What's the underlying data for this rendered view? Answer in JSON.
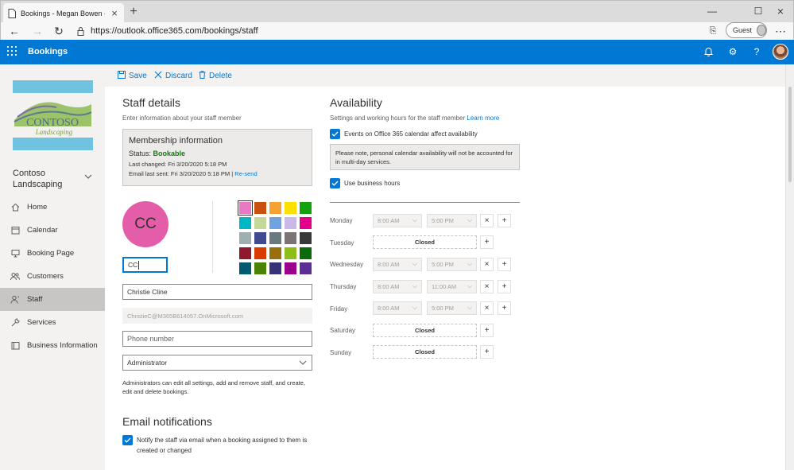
{
  "browser": {
    "tab_title": "Bookings - Megan Bowen - Outl",
    "url": "https://outlook.office365.com/bookings/staff",
    "guest_label": "Guest"
  },
  "app": {
    "title": "Bookings",
    "brand_color": "#0078d4"
  },
  "sidebar": {
    "logo_text": "CONTOSO",
    "logo_subtext": "Landscaping",
    "business_name": "Contoso Landscaping",
    "items": [
      {
        "label": "Home",
        "icon": "home-icon"
      },
      {
        "label": "Calendar",
        "icon": "calendar-icon"
      },
      {
        "label": "Booking Page",
        "icon": "monitor-icon"
      },
      {
        "label": "Customers",
        "icon": "people-icon"
      },
      {
        "label": "Staff",
        "icon": "staff-icon",
        "selected": true
      },
      {
        "label": "Services",
        "icon": "wrench-icon"
      },
      {
        "label": "Business Information",
        "icon": "building-icon"
      }
    ]
  },
  "toolbar": {
    "save_label": "Save",
    "discard_label": "Discard",
    "delete_label": "Delete"
  },
  "staff": {
    "heading": "Staff details",
    "subheading": "Enter information about your staff member",
    "membership": {
      "title": "Membership information",
      "status_label": "Status:",
      "status_value": "Bookable",
      "last_changed": "Last changed: Fri 3/20/2020 5:18 PM",
      "email_last_sent": "Email last sent: Fri 3/20/2020 5:18 PM |",
      "resend_label": "Re-send"
    },
    "initials_display": "CC",
    "initials_value": "CC",
    "name_value": "Christie Cline",
    "email_value": "ChristieC@M365B614057.OnMicrosoft.com",
    "phone_placeholder": "Phone number",
    "role_value": "Administrator",
    "role_description": "Administrators can edit all settings, add and remove staff, and create, edit and delete bookings.",
    "swatches": [
      "#e879c4",
      "#ca5010",
      "#f7a133",
      "#fce100",
      "#13a10e",
      "#00b7c3",
      "#c4d89a",
      "#6fa3e0",
      "#c9b8e8",
      "#e3008c",
      "#a0aeb2",
      "#404b8f",
      "#69797e",
      "#7a7574",
      "#393939",
      "#8e192e",
      "#da3b01",
      "#986f0b",
      "#8cbd18",
      "#0b6a0b",
      "#005b70",
      "#498205",
      "#373277",
      "#9a0089",
      "#5c2e91"
    ],
    "selected_swatch": 0
  },
  "notifications": {
    "heading": "Email notifications",
    "notify_label_line1": "Notify the staff via email when a booking assigned to them is",
    "notify_label_line2": "created or changed"
  },
  "availability": {
    "heading": "Availability",
    "subheading": "Settings and working hours for the staff member",
    "learn_more": "Learn more",
    "o365_label": "Events on Office 365 calendar affect availability",
    "note_line1": "Please note, personal calendar availability will not be accounted for",
    "note_line2": "in multi-day services.",
    "business_hours_label": "Use business hours",
    "days": [
      {
        "day": "Monday",
        "start": "8:00 AM",
        "end": "5:00 PM",
        "closed": false
      },
      {
        "day": "Tuesday",
        "closed": true,
        "closed_label": "Closed"
      },
      {
        "day": "Wednesday",
        "start": "8:00 AM",
        "end": "5:00 PM",
        "closed": false
      },
      {
        "day": "Thursday",
        "start": "8:00 AM",
        "end": "11:00 AM",
        "closed": false
      },
      {
        "day": "Friday",
        "start": "8:00 AM",
        "end": "5:00 PM",
        "closed": false
      },
      {
        "day": "Saturday",
        "closed": true,
        "closed_label": "Closed"
      },
      {
        "day": "Sunday",
        "closed": true,
        "closed_label": "Closed"
      }
    ]
  }
}
